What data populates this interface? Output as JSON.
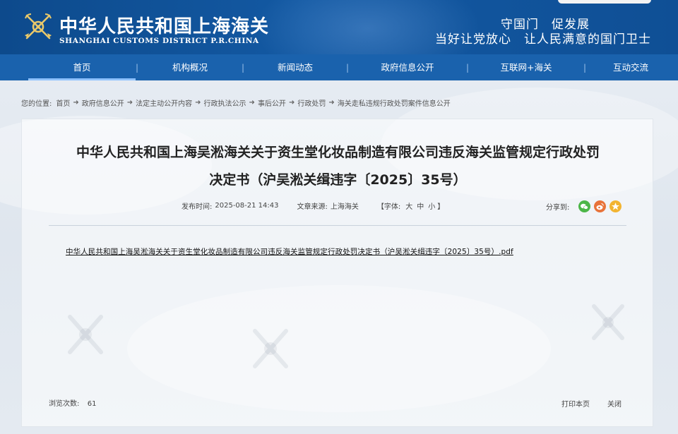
{
  "header": {
    "site_title": "中华人民共和国上海海关",
    "site_subtitle": "SHANGHAI CUSTOMS DISTRICT P.R.CHINA",
    "slogan_line1": "守国门　促发展",
    "slogan_line2": "当好让党放心　让人民满意的国门卫士",
    "emblem_icon": "customs-emblem-icon"
  },
  "nav": {
    "items": [
      {
        "label": "首页"
      },
      {
        "label": "机构概况"
      },
      {
        "label": "新闻动态"
      },
      {
        "label": "政府信息公开"
      },
      {
        "label": "互联网+海关"
      },
      {
        "label": "互动交流"
      }
    ],
    "separator": "|"
  },
  "breadcrumb": {
    "prefix": "您的位置:",
    "items": [
      "首页",
      "政府信息公开",
      "法定主动公开内容",
      "行政执法公示",
      "事后公开",
      "行政处罚",
      "海关走私违规行政处罚案件信息公开"
    ],
    "arrow": "➜"
  },
  "article": {
    "title_line1": "中华人民共和国上海吴淞海关关于资生堂化妆品制造有限公司违反海关监管规定行政处罚",
    "title_line2": "决定书（沪吴淞关缉违字〔2025〕35号）",
    "publish_label": "发布时间:",
    "publish_time": "2025-08-21 14:43",
    "source_label": "文章来源:",
    "source": "上海海关",
    "font_label_open": "【字体:",
    "font_large": "大",
    "font_medium": "中",
    "font_small": "小",
    "font_label_close": "】",
    "share_label": "分享到:",
    "share_icons": [
      "wechat-icon",
      "weibo-icon",
      "favorite-star-icon"
    ],
    "attachment": "中华人民共和国上海吴淞海关关于资生堂化妆品制造有限公司违反海关监管规定行政处罚决定书（沪吴淞关缉违字〔2025〕35号）.pdf"
  },
  "footer": {
    "view_label": "浏览次数:",
    "view_count": "61",
    "print": "打印本页",
    "close": "关闭"
  },
  "colors": {
    "header_blue": "#0d4a8c",
    "nav_blue": "#1a62ad",
    "wechat_green": "#4cb648",
    "weibo_orange": "#e8733a",
    "star_gold": "#f2b431"
  }
}
